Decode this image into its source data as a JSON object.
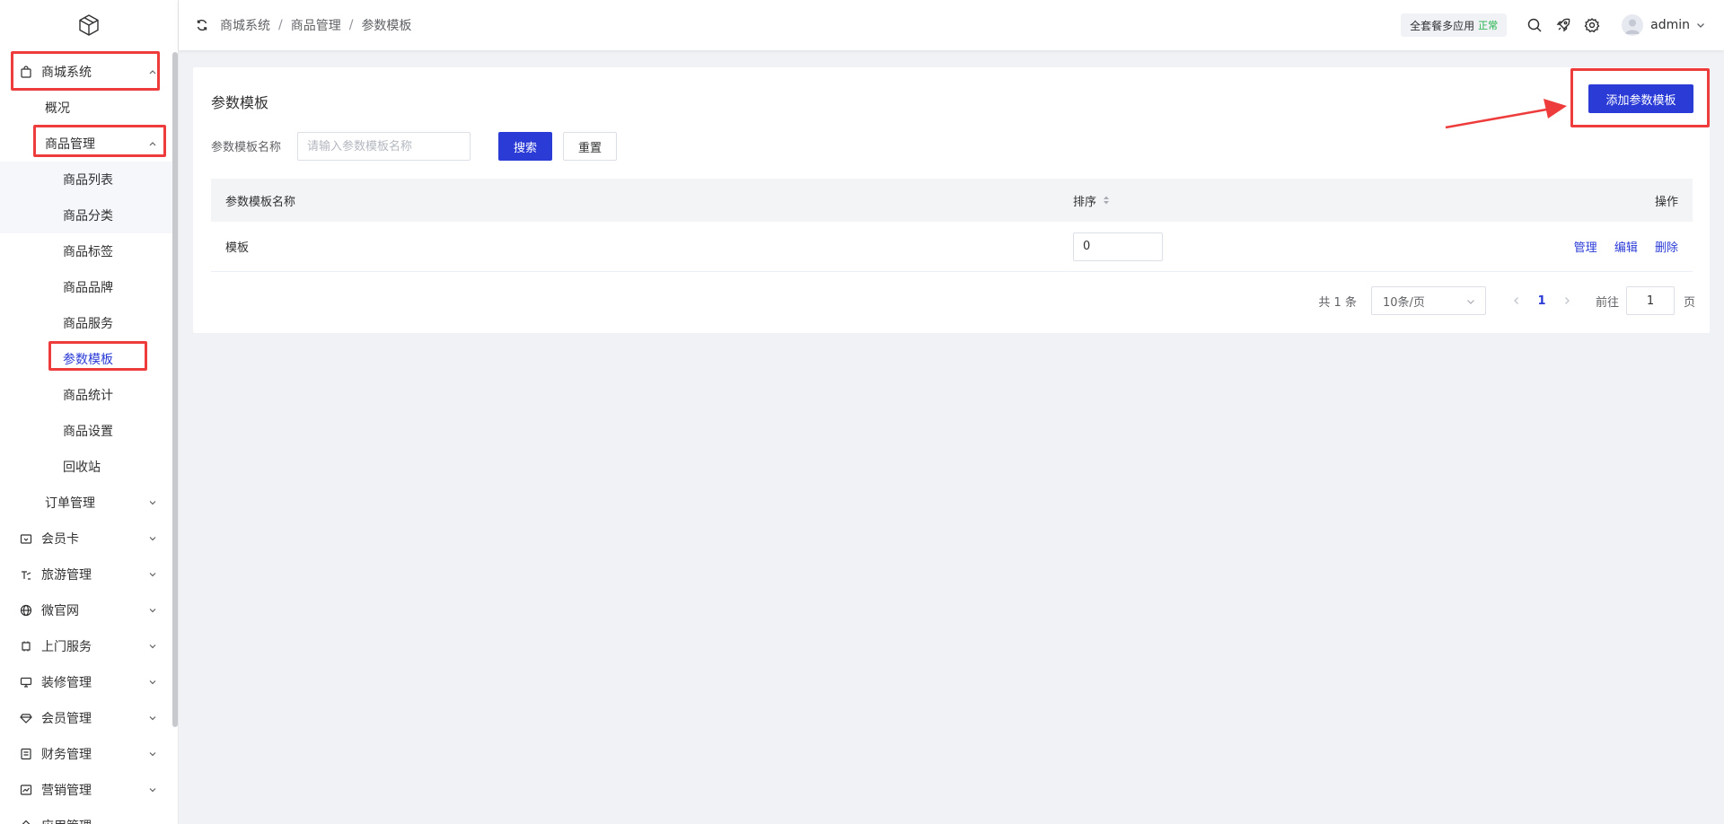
{
  "sidebar": {
    "items": [
      {
        "label": "商城系统",
        "icon": "bag-icon"
      },
      {
        "label": "概况"
      },
      {
        "label": "商品管理"
      },
      {
        "label": "商品列表"
      },
      {
        "label": "商品分类"
      },
      {
        "label": "商品标签"
      },
      {
        "label": "商品品牌"
      },
      {
        "label": "商品服务"
      },
      {
        "label": "参数模板"
      },
      {
        "label": "商品统计"
      },
      {
        "label": "商品设置"
      },
      {
        "label": "回收站"
      },
      {
        "label": "订单管理"
      },
      {
        "label": "会员卡",
        "icon": "card-icon"
      },
      {
        "label": "旅游管理",
        "icon": "travel-icon"
      },
      {
        "label": "微官网",
        "icon": "globe-icon"
      },
      {
        "label": "上门服务",
        "icon": "service-icon"
      },
      {
        "label": "装修管理",
        "icon": "decor-icon"
      },
      {
        "label": "会员管理",
        "icon": "diamond-icon"
      },
      {
        "label": "财务管理",
        "icon": "finance-icon"
      },
      {
        "label": "营销管理",
        "icon": "chart-icon"
      },
      {
        "label": "应用管理",
        "icon": "app-icon"
      }
    ]
  },
  "header": {
    "breadcrumb": [
      "商城系统",
      "商品管理",
      "参数模板"
    ],
    "package_label": "全套餐多应用",
    "package_status": "正常",
    "username": "admin"
  },
  "main": {
    "title": "参数模板",
    "add_button": "添加参数模板",
    "filter": {
      "label": "参数模板名称",
      "placeholder": "请输入参数模板名称",
      "search_button": "搜索",
      "reset_button": "重置"
    },
    "table": {
      "columns": [
        "参数模板名称",
        "排序",
        "操作"
      ],
      "rows": [
        {
          "name": "模板",
          "sort": "0",
          "actions": [
            "管理",
            "编辑",
            "删除"
          ]
        }
      ]
    },
    "pagination": {
      "total": "共 1 条",
      "page_size": "10条/页",
      "current_page": "1",
      "goto_label": "前往",
      "goto_value": "1",
      "goto_suffix": "页"
    }
  },
  "colors": {
    "primary": "#2a3bd6",
    "highlight": "#ee3b3b",
    "status_ok": "#22b34a"
  }
}
